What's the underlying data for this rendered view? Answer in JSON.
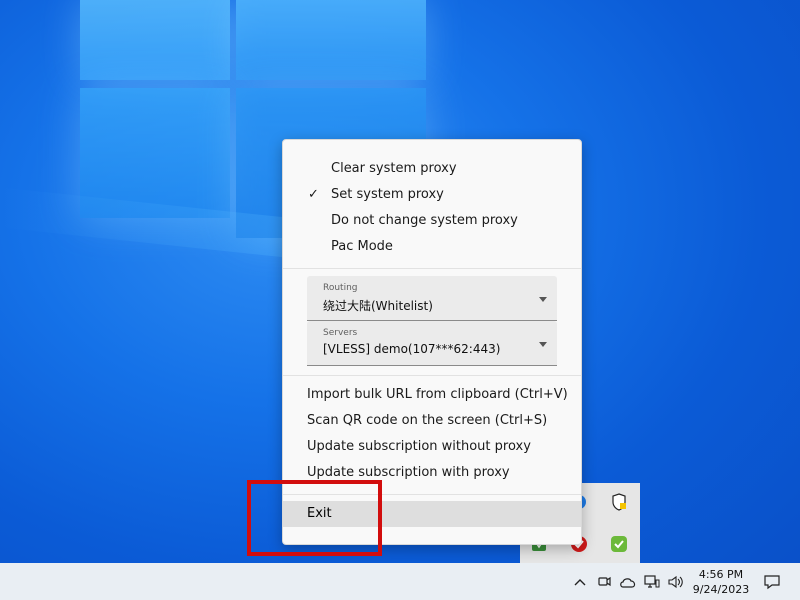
{
  "menu": {
    "proxy_items": [
      {
        "label": "Clear system proxy",
        "checked": false
      },
      {
        "label": "Set system proxy",
        "checked": true
      },
      {
        "label": "Do not change system proxy",
        "checked": false
      },
      {
        "label": "Pac Mode",
        "checked": false
      }
    ],
    "check_glyph": "✓",
    "routing": {
      "label": "Routing",
      "value": "绕过大陆(Whitelist)"
    },
    "servers": {
      "label": "Servers",
      "value": "[VLESS] demo(107***62:443)"
    },
    "actions": [
      "Import bulk URL from clipboard (Ctrl+V)",
      "Scan QR code on the screen (Ctrl+S)",
      "Update subscription without proxy",
      "Update subscription with proxy"
    ],
    "exit_label": "Exit"
  },
  "taskbar": {
    "time": "4:56 PM",
    "date": "9/24/2023",
    "icons": [
      "chevron-up-icon",
      "meet-now-icon",
      "onedrive-icon",
      "network-icon",
      "volume-icon",
      "notification-icon"
    ]
  },
  "tray_flyout": {
    "icons": [
      "bluetooth-icon",
      "windows-security-icon",
      "v2rayn-icon",
      "red-app-icon",
      "green-check-icon"
    ]
  },
  "colors": {
    "highlight_box": "#d20d0d",
    "menu_bg": "#f9f9f9",
    "desktop": "#0b5bd6",
    "taskbar": "#e9eef3"
  }
}
